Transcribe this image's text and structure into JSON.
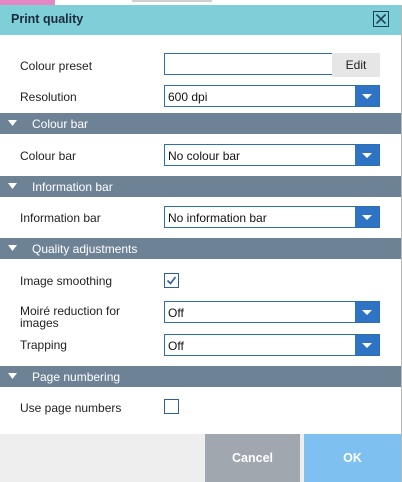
{
  "dialog": {
    "title": "Print quality"
  },
  "colour_preset": {
    "label": "Colour preset",
    "value": "",
    "edit_label": "Edit"
  },
  "resolution": {
    "label": "Resolution",
    "value": "600 dpi"
  },
  "sections": {
    "colour_bar": {
      "title": "Colour bar",
      "field_label": "Colour bar",
      "value": "No colour bar"
    },
    "information_bar": {
      "title": "Information bar",
      "field_label": "Information bar",
      "value": "No information bar"
    },
    "quality_adjustments": {
      "title": "Quality adjustments",
      "image_smoothing_label": "Image smoothing",
      "image_smoothing_checked": true,
      "moire_label_line1": "Moiré reduction for",
      "moire_label_line2": "images",
      "moire_value": "Off",
      "trapping_label": "Trapping",
      "trapping_value": "Off"
    },
    "page_numbering": {
      "title": "Page numbering",
      "use_page_numbers_label": "Use page numbers",
      "use_page_numbers_checked": false
    }
  },
  "footer": {
    "cancel_label": "Cancel",
    "ok_label": "OK"
  },
  "colors": {
    "title_bar": "#7ecfd8",
    "section_header": "#6e8296",
    "dropdown_accent": "#2f73c4",
    "ok_button": "#7ec0ef",
    "cancel_button": "#a0a7ae"
  },
  "icons": {
    "close": "close-icon",
    "dropdown": "chevron-down-icon",
    "section_toggle": "collapse-triangle-icon",
    "check": "checkmark-icon"
  }
}
